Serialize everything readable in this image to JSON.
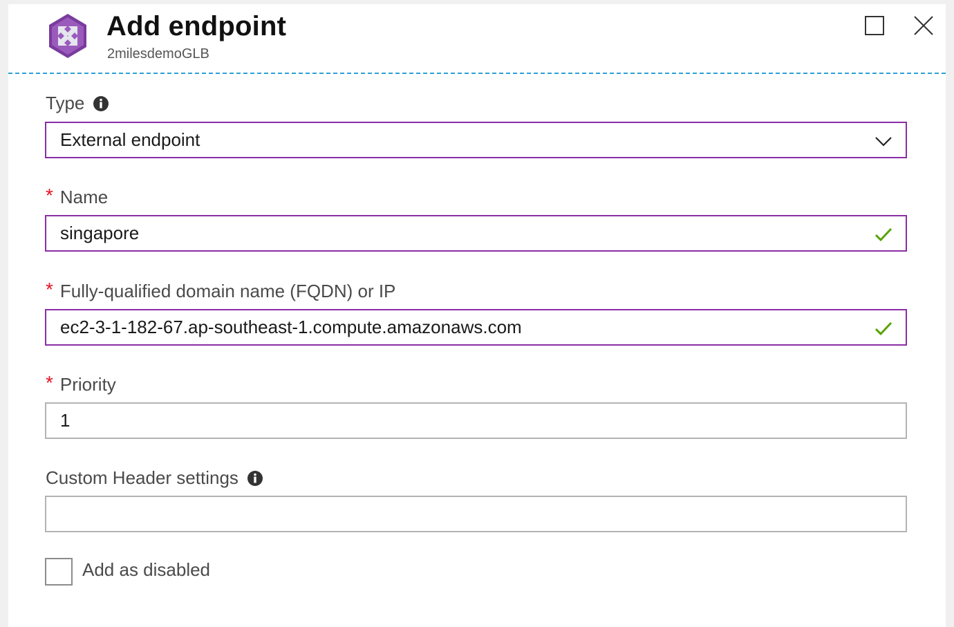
{
  "header": {
    "title": "Add endpoint",
    "subtitle": "2milesdemoGLB",
    "icon": "traffic-manager-icon",
    "icon_color": "#7a3c9c"
  },
  "window_controls": {
    "maximize_icon": "maximize-icon",
    "close_icon": "close-icon"
  },
  "form": {
    "type": {
      "label": "Type",
      "value": "External endpoint",
      "has_info": true
    },
    "name": {
      "label": "Name",
      "required_mark": "*",
      "value": "singapore",
      "valid": true
    },
    "fqdn": {
      "label": "Fully-qualified domain name (FQDN) or IP",
      "required_mark": "*",
      "value": "ec2-3-1-182-67.ap-southeast-1.compute.amazonaws.com",
      "valid": true
    },
    "priority": {
      "label": "Priority",
      "required_mark": "*",
      "value": "1"
    },
    "custom_header": {
      "label": "Custom Header settings",
      "value": "",
      "has_info": true
    },
    "add_disabled": {
      "label": "Add as disabled",
      "checked": false
    }
  },
  "colors": {
    "accent_border": "#8a2da5",
    "valid_check": "#57a300",
    "required": "#e81123",
    "divider": "#2aa0d6"
  }
}
